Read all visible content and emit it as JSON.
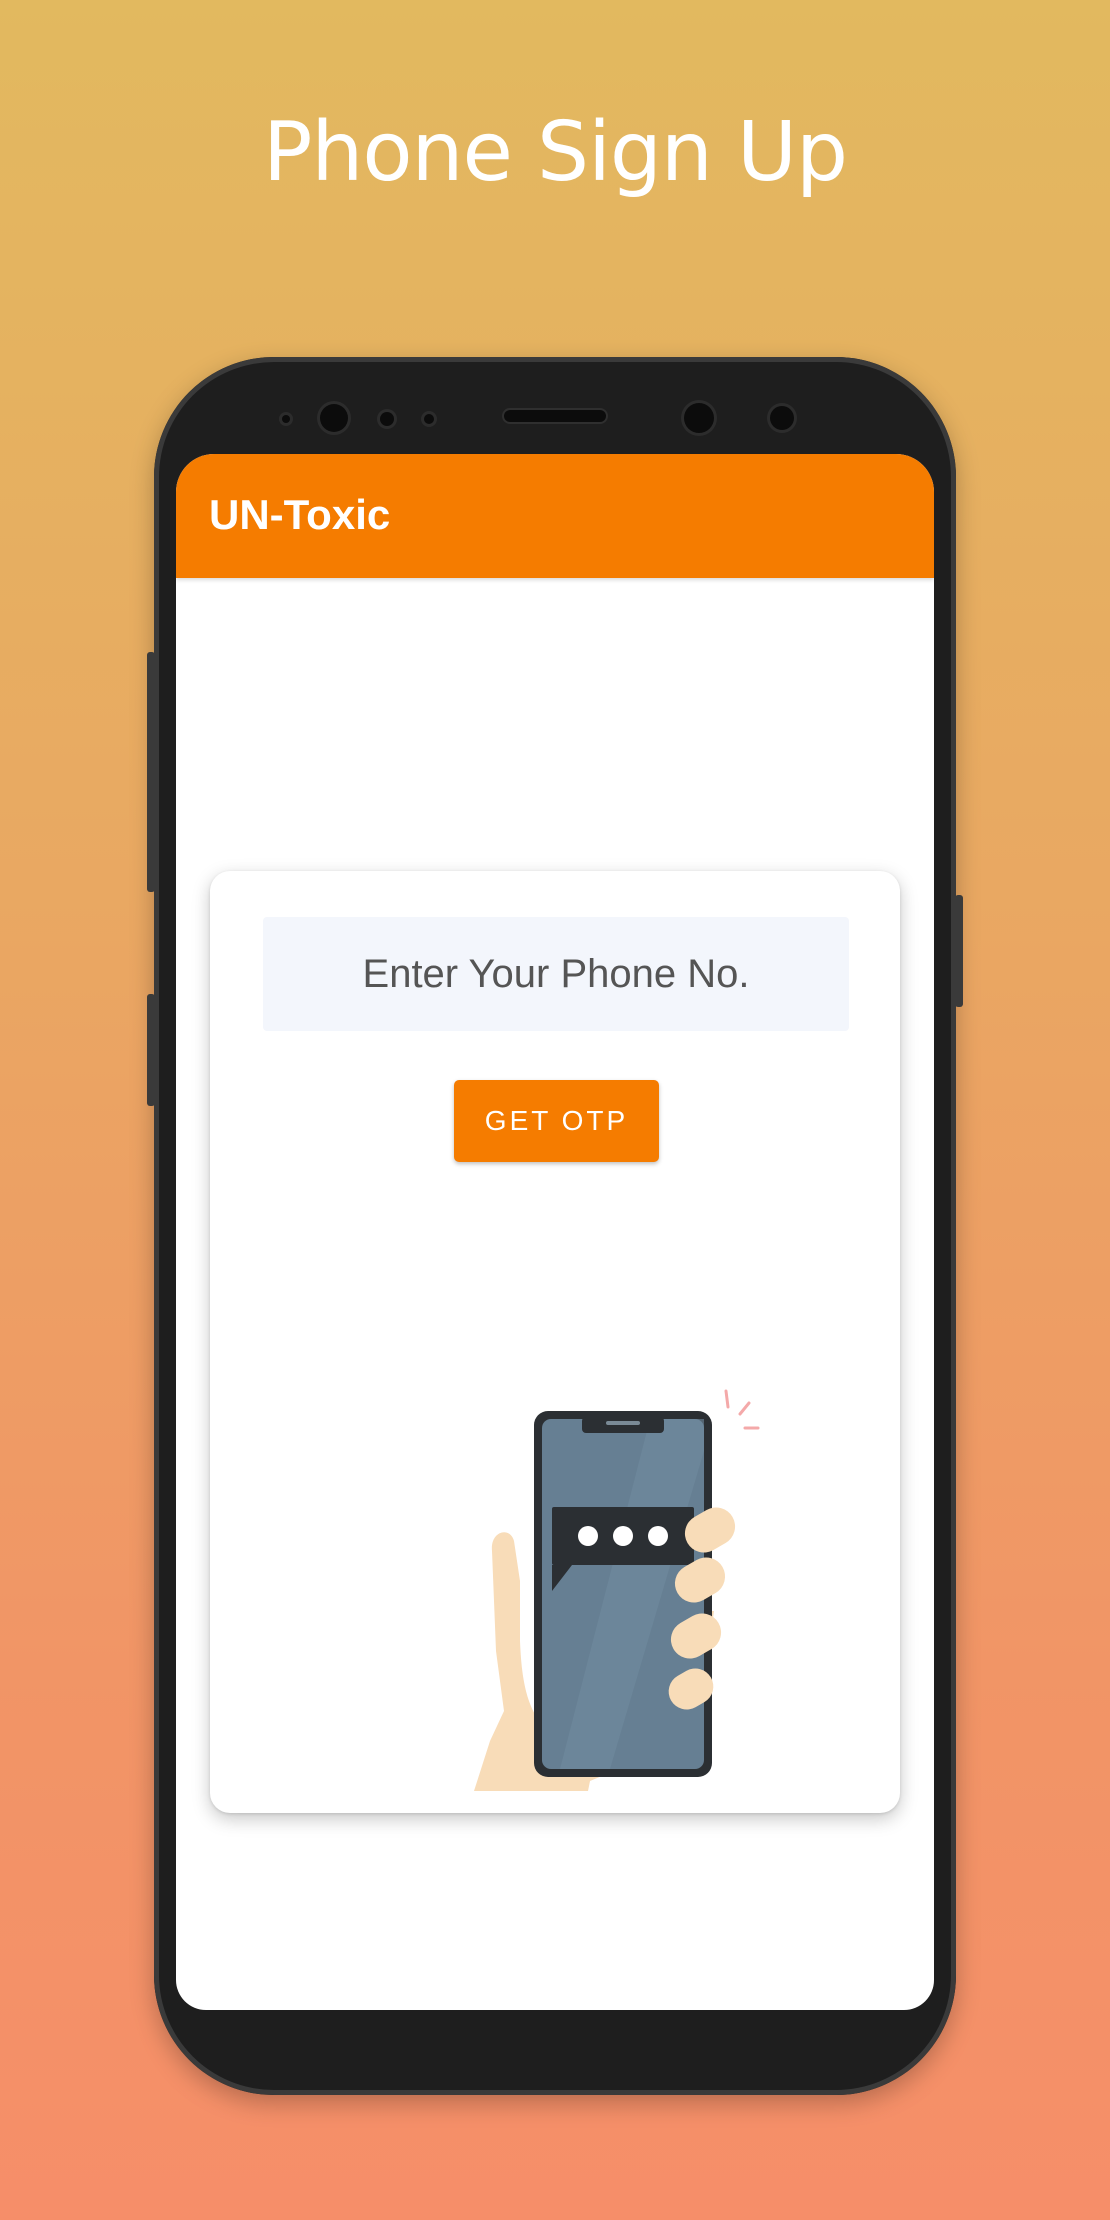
{
  "promo": {
    "title": "Phone Sign Up"
  },
  "app": {
    "title": "UN-Toxic",
    "accent_color": "#f57c00"
  },
  "form": {
    "phone_placeholder": "Enter Your Phone No.",
    "otp_button_label": "GET OTP"
  },
  "illustration": {
    "icon": "hand-holding-phone-with-message"
  }
}
